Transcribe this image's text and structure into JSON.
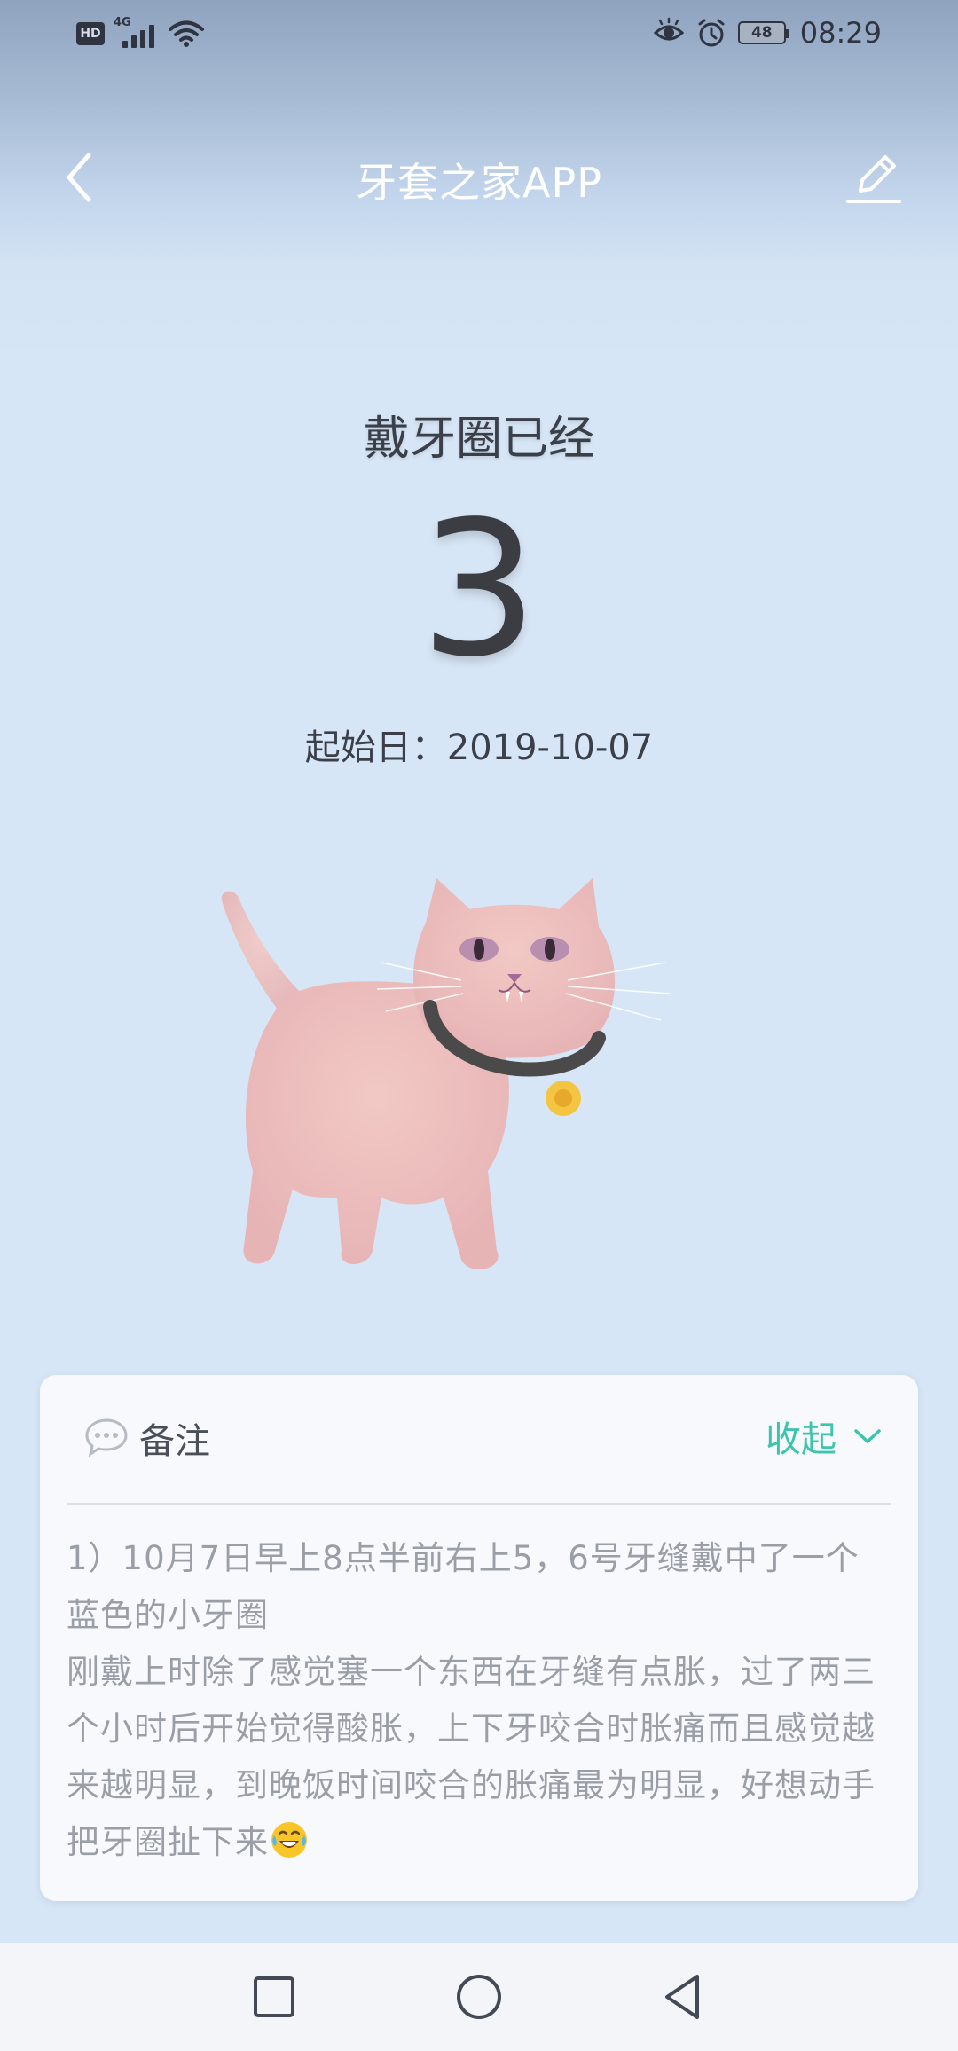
{
  "status_bar": {
    "hd": "HD",
    "network": "4G",
    "battery": "48",
    "time": "08:29"
  },
  "header": {
    "title": "牙套之家APP",
    "back_icon": "chevron-left-icon",
    "edit_icon": "pencil-icon"
  },
  "counter": {
    "label": "戴牙圈已经",
    "value": "3",
    "start_date": "起始日：2019-10-07"
  },
  "illustration": {
    "icon": "cat-illustration"
  },
  "note": {
    "title": "备注",
    "collapse_label": "收起",
    "lines": [
      "1）10月7日早上8点半前右上5，6号牙缝戴中了一个蓝色的小牙圈",
      "刚戴上时除了感觉塞一个东西在牙缝有点胀，过了两三个小时后开始觉得酸胀，上下牙咬合时胀痛而且感觉越来越明显，到晚饭时间咬合的胀痛最为明显，好想动手把牙圈扯下来"
    ],
    "emoji": "tears-of-joy-emoji"
  },
  "nav_bar": {
    "recent_icon": "square-icon",
    "home_icon": "circle-icon",
    "back_icon": "triangle-back-icon"
  },
  "colors": {
    "background": "#d7e6f6",
    "accent": "#3cc4ad",
    "card": "#f7f9fc",
    "text_dark": "#3b3d42",
    "text_muted": "#9a9ea6"
  }
}
